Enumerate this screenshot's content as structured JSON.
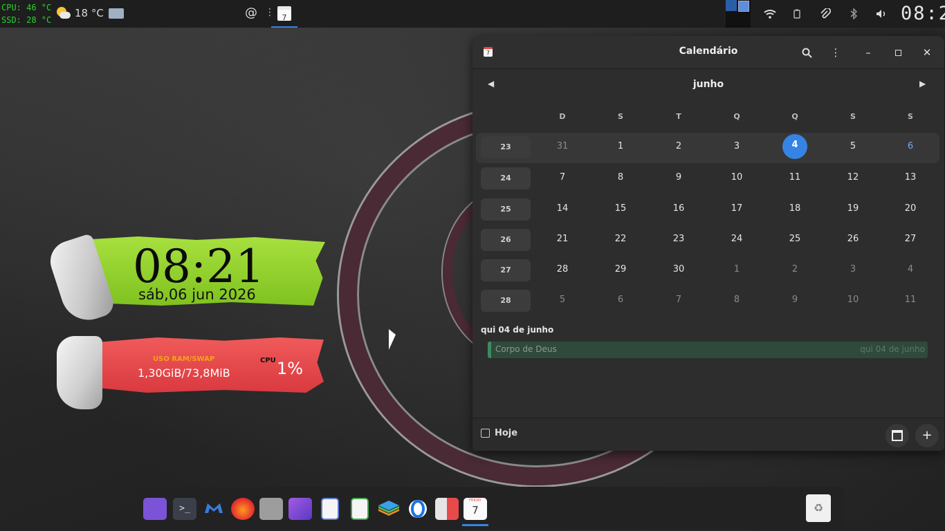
{
  "topbar": {
    "cpu_temp": "CPU: 46 °C",
    "ssd_temp": "SSD: 28 °C",
    "weather_icon": "partly-cloudy-icon",
    "weather_temp": "18 °C",
    "calendar_badge": "7",
    "clock": "08:2"
  },
  "widgets": {
    "clock": "08:21",
    "date": "sáb,06 jun 2026",
    "ram_label": "USO RAM/SWAP",
    "ram_value": "1,30GiB/73,8MiB",
    "cpu_label": "CPU",
    "cpu_value": "1%"
  },
  "calendar": {
    "title": "Calendário",
    "app_icon_number": "7",
    "month": "junho",
    "weekday_headers": [
      "D",
      "S",
      "T",
      "Q",
      "Q",
      "S",
      "S"
    ],
    "weeks": [
      {
        "number": "23",
        "days": [
          "31",
          "1",
          "2",
          "3",
          "4",
          "5",
          "6"
        ]
      },
      {
        "number": "24",
        "days": [
          "7",
          "8",
          "9",
          "10",
          "11",
          "12",
          "13"
        ]
      },
      {
        "number": "25",
        "days": [
          "14",
          "15",
          "16",
          "17",
          "18",
          "19",
          "20"
        ]
      },
      {
        "number": "26",
        "days": [
          "21",
          "22",
          "23",
          "24",
          "25",
          "26",
          "27"
        ]
      },
      {
        "number": "27",
        "days": [
          "28",
          "29",
          "30",
          "1",
          "2",
          "3",
          "4"
        ]
      },
      {
        "number": "28",
        "days": [
          "5",
          "6",
          "7",
          "8",
          "9",
          "10",
          "11"
        ]
      }
    ],
    "selected_date_heading": "qui 04 de junho",
    "event": {
      "name": "Corpo de Deus",
      "date": "qui 04 de junho"
    },
    "today_button": "Hoje",
    "accent": "#3584e4",
    "event_color": "#3d8a5e"
  },
  "dock": {
    "apps": [
      "files",
      "terminal",
      "mailspring",
      "firefox",
      "settings",
      "screenshot",
      "text-editor",
      "spreadsheet",
      "layers",
      "opera",
      "calculator",
      "calendar"
    ],
    "calendar_day_label": "FRIDAY",
    "calendar_day_number": "7"
  }
}
